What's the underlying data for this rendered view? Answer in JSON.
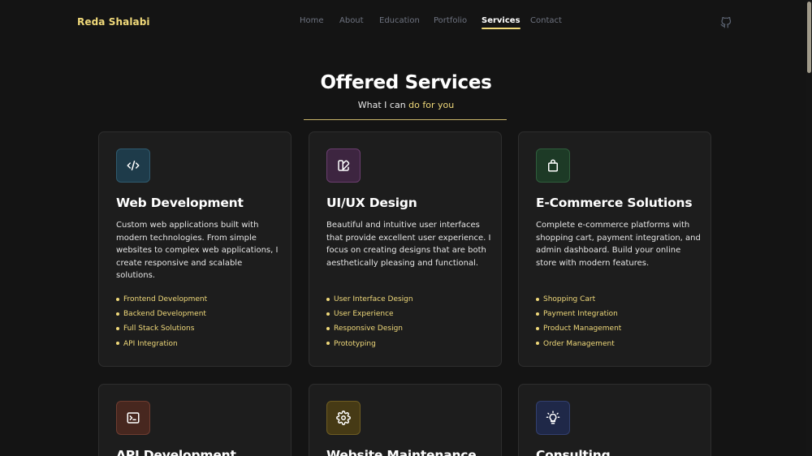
{
  "header": {
    "brand": "Reda Shalabi",
    "nav": [
      {
        "label": "Home"
      },
      {
        "label": "About"
      },
      {
        "label": "Education"
      },
      {
        "label": "Portfolio"
      },
      {
        "label": "Services",
        "active": true
      },
      {
        "label": "Contact"
      }
    ],
    "github_icon": "github-icon"
  },
  "section": {
    "title": "Offered Services",
    "subtitle_prefix": "What I can ",
    "subtitle_highlight": "do for you"
  },
  "colors": {
    "accent": "#f0d97a",
    "background": "#141414",
    "card": "#1d1d1d"
  },
  "services": [
    {
      "icon": "code-icon",
      "title": "Web Development",
      "description": "Custom web applications built with modern technologies. From simple websites to complex web applications, I create responsive and scalable solutions.",
      "features": [
        "Frontend Development",
        "Backend Development",
        "Full Stack Solutions",
        "API Integration"
      ]
    },
    {
      "icon": "design-icon",
      "title": "UI/UX Design",
      "description": "Beautiful and intuitive user interfaces that provide excellent user experience. I focus on creating designs that are both aesthetically pleasing and functional.",
      "features": [
        "User Interface Design",
        "User Experience",
        "Responsive Design",
        "Prototyping"
      ]
    },
    {
      "icon": "shopping-bag-icon",
      "title": "E-Commerce Solutions",
      "description": "Complete e-commerce platforms with shopping cart, payment integration, and admin dashboard. Build your online store with modern features.",
      "features": [
        "Shopping Cart",
        "Payment Integration",
        "Product Management",
        "Order Management"
      ]
    },
    {
      "icon": "terminal-icon",
      "title": "API Development",
      "description": "",
      "features": []
    },
    {
      "icon": "gear-icon",
      "title": "Website Maintenance",
      "description": "",
      "features": []
    },
    {
      "icon": "lightbulb-icon",
      "title": "Consulting",
      "description": "",
      "features": []
    }
  ]
}
